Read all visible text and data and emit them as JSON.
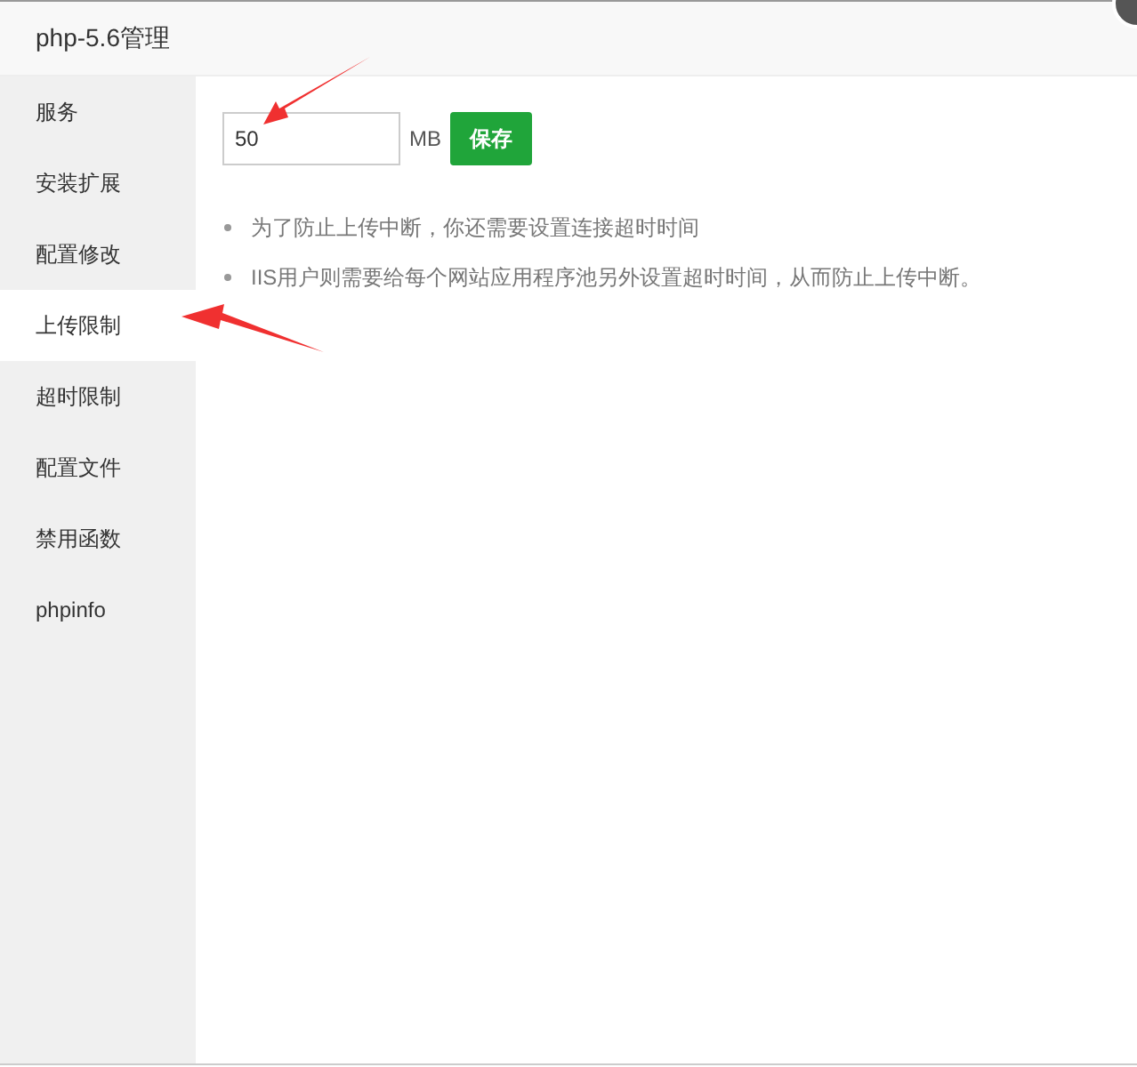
{
  "window": {
    "title": "php-5.6管理"
  },
  "sidebar": {
    "items": [
      {
        "label": "服务",
        "selected": false
      },
      {
        "label": "安装扩展",
        "selected": false
      },
      {
        "label": "配置修改",
        "selected": false
      },
      {
        "label": "上传限制",
        "selected": true
      },
      {
        "label": "超时限制",
        "selected": false
      },
      {
        "label": "配置文件",
        "selected": false
      },
      {
        "label": "禁用函数",
        "selected": false
      },
      {
        "label": "phpinfo",
        "selected": false
      }
    ]
  },
  "upload_limit": {
    "value": "50",
    "unit": "MB",
    "save_button": "保存"
  },
  "notes": [
    "为了防止上传中断，你还需要设置连接超时时间",
    "IIS用户则需要给每个网站应用程序池另外设置超时时间，从而防止上传中断。"
  ]
}
